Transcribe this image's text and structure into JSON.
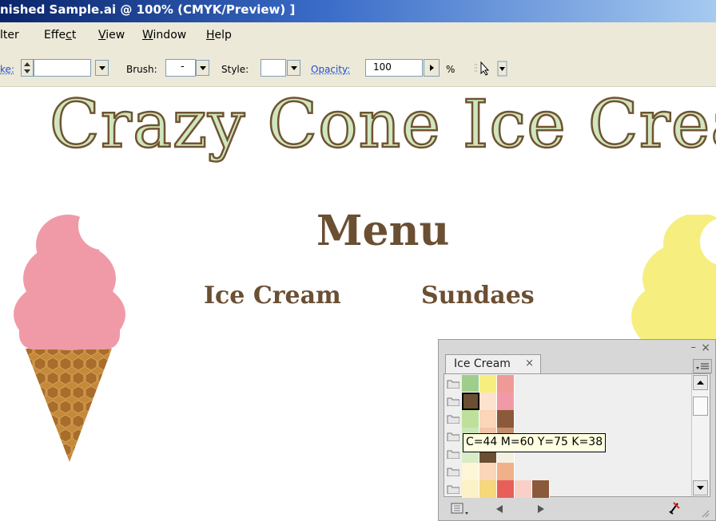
{
  "window": {
    "title": "nished Sample.ai @ 100% (CMYK/Preview) ]"
  },
  "menubar": {
    "items": [
      {
        "name": "menu-filter",
        "label": "lter",
        "underline": ""
      },
      {
        "name": "menu-effect",
        "label": "Effect",
        "underline": "c"
      },
      {
        "name": "menu-view",
        "label": "View",
        "underline": "V"
      },
      {
        "name": "menu-window",
        "label": "Window",
        "underline": "W"
      },
      {
        "name": "menu-help",
        "label": "Help",
        "underline": "H"
      }
    ]
  },
  "controlbar": {
    "stroke_label": "ke:",
    "brush_label": "Brush:",
    "brush_value": "-",
    "style_label": "Style:",
    "opacity_label": "Opacity:",
    "opacity_value": "100",
    "percent": "%"
  },
  "artboard": {
    "title": "Crazy Cone Ice Cream",
    "menu_heading": "Menu",
    "link_ice_cream": "Ice Cream",
    "link_sundaes": "Sundaes"
  },
  "swatch_panel": {
    "tab_label": "Ice Cream",
    "tab_close": "×",
    "minimize": "–",
    "close": "×",
    "tooltip": "C=44 M=60 Y=75 K=38",
    "rows": [
      [
        "#9ecf8a",
        "#f6ef7f",
        "#ef9a96"
      ],
      [
        "#6b4f33",
        "#fde2cf",
        "#f09aa8"
      ],
      [
        "#bfe09a",
        "#fbd6b8",
        "#8b5a3a"
      ],
      [
        "#c9e6b8",
        "#f2c6a8",
        "#c48e6c"
      ],
      [
        "#d8ecc8",
        "#6b4f33",
        "#f4f0e0"
      ],
      [
        "#fdf7d8",
        "#fbd6b8",
        "#f0b08a"
      ],
      [
        "#fdf1c8",
        "#f6d77a",
        "#e85e5a",
        "#f9d0c8",
        "#8b5a3a"
      ]
    ]
  },
  "colors": {
    "title_fill": "#cfe6c0",
    "title_stroke": "#6f5430",
    "brown": "#6b4f33",
    "pink_scoop": "#f09aa8",
    "yellow_scoop": "#f6ef7f",
    "cone": "#c48a3a"
  }
}
